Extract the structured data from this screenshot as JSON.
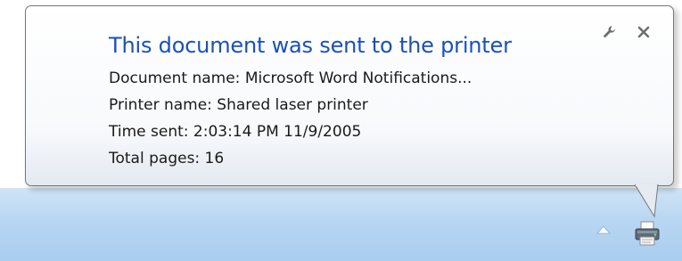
{
  "notification": {
    "title": "This document was sent to the printer",
    "document_name": "Document name:  Microsoft Word Notifications...",
    "printer_name": "Printer name:  Shared laser printer",
    "time_sent": "Time sent:  2:03:14 PM 11/9/2005",
    "total_pages": "Total pages: 16"
  },
  "controls": {
    "options_icon": "wrench-icon",
    "close_icon": "close-icon"
  },
  "tray": {
    "show_hidden_icon": "triangle-up-icon",
    "printer_icon": "printer-icon"
  },
  "colors": {
    "title": "#1b50b8",
    "taskbar": "#b8d6f2",
    "balloon_border": "#767676"
  }
}
